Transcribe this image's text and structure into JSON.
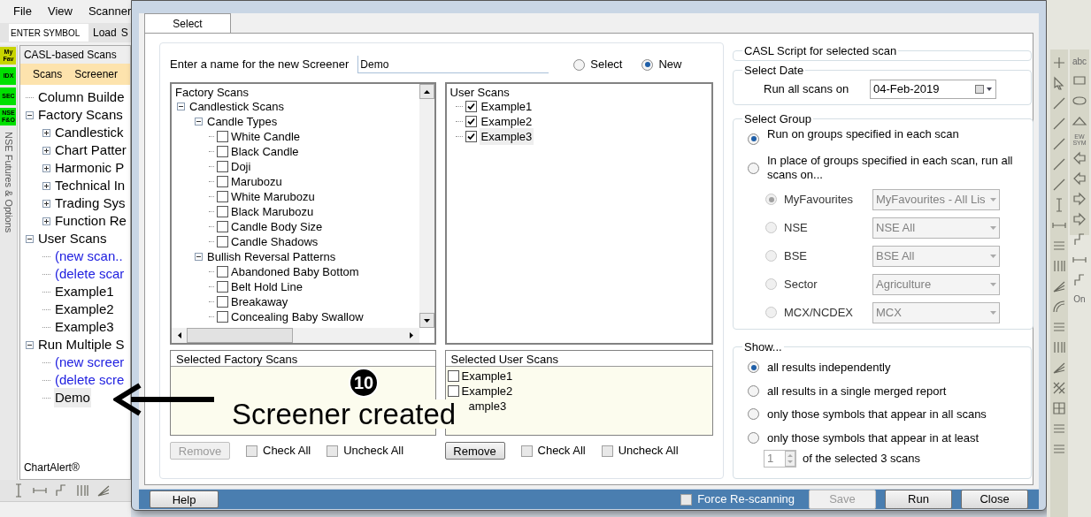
{
  "app": {
    "menu": [
      "File",
      "View",
      "Scanner"
    ],
    "symbol_field": {
      "placeholder": "ENTER SYMBOL"
    },
    "toolbar_buttons": [
      "Load",
      "S"
    ],
    "side_tabs": [
      {
        "label": "My Fav",
        "color": "#c8d400"
      },
      {
        "label": "IDX",
        "color": "#00e000"
      },
      {
        "label": "SEC",
        "color": "#00e000"
      },
      {
        "label": "NSE F&O",
        "color": "#00e000"
      }
    ],
    "vertical_tab": "NSE Futures & Options",
    "panel_title": "CASL-based Scans",
    "panel_tabs": [
      "Scans",
      "Screener"
    ],
    "tree": [
      {
        "label": "Column Builde",
        "kind": "item",
        "selected": false
      },
      {
        "label": "Factory Scans",
        "kind": "group",
        "expanded": true,
        "children": [
          {
            "label": "Candlestick",
            "kind": "group",
            "expanded": false
          },
          {
            "label": "Chart Patter",
            "kind": "group",
            "expanded": false
          },
          {
            "label": "Harmonic P",
            "kind": "group",
            "expanded": false
          },
          {
            "label": "Technical In",
            "kind": "group",
            "expanded": false
          },
          {
            "label": "Trading Sys",
            "kind": "group",
            "expanded": false
          },
          {
            "label": "Function Re",
            "kind": "group",
            "expanded": false
          }
        ]
      },
      {
        "label": "User Scans",
        "kind": "group",
        "expanded": true,
        "children": [
          {
            "label": "(new scan..",
            "kind": "link",
            "selected": false
          },
          {
            "label": "(delete scar",
            "kind": "link",
            "selected": false
          },
          {
            "label": "Example1",
            "kind": "item",
            "selected": false
          },
          {
            "label": "Example2",
            "kind": "item",
            "selected": false
          },
          {
            "label": "Example3",
            "kind": "item",
            "selected": false
          }
        ]
      },
      {
        "label": "Run Multiple S",
        "kind": "group",
        "expanded": true,
        "children": [
          {
            "label": "(new screer",
            "kind": "link",
            "selected": false
          },
          {
            "label": "(delete scre",
            "kind": "link",
            "selected": false
          },
          {
            "label": "Demo",
            "kind": "item",
            "selected": true
          }
        ]
      }
    ],
    "brand": "ChartAlert®"
  },
  "dialog": {
    "tabs": [
      {
        "label": "Select",
        "selected": true
      }
    ],
    "name_label": "Enter a name for the new Screener",
    "name_value": "Demo",
    "mode_options": [
      {
        "label": "Select",
        "selected": false
      },
      {
        "label": "New",
        "selected": true
      }
    ],
    "factory_scans": {
      "title": "Factory Scans",
      "tree": [
        {
          "label": "Candlestick Scans",
          "kind": "group",
          "expanded": true,
          "children": [
            {
              "label": "Candle Types",
              "kind": "group",
              "expanded": true,
              "children": [
                {
                  "label": "White Candle",
                  "kind": "check",
                  "checked": false
                },
                {
                  "label": "Black Candle",
                  "kind": "check",
                  "checked": false
                },
                {
                  "label": "Doji",
                  "kind": "check",
                  "checked": false
                },
                {
                  "label": "Marubozu",
                  "kind": "check",
                  "checked": false
                },
                {
                  "label": "White Marubozu",
                  "kind": "check",
                  "checked": false
                },
                {
                  "label": "Black Marubozu",
                  "kind": "check",
                  "checked": false
                },
                {
                  "label": "Candle Body Size",
                  "kind": "check",
                  "checked": false
                },
                {
                  "label": "Candle Shadows",
                  "kind": "check",
                  "checked": false
                }
              ]
            },
            {
              "label": "Bullish Reversal Patterns",
              "kind": "group",
              "expanded": true,
              "children": [
                {
                  "label": "Abandoned Baby Bottom",
                  "kind": "check",
                  "checked": false
                },
                {
                  "label": "Belt Hold Line",
                  "kind": "check",
                  "checked": false
                },
                {
                  "label": "Breakaway",
                  "kind": "check",
                  "checked": false
                },
                {
                  "label": "Concealing Baby Swallow",
                  "kind": "check",
                  "checked": false
                }
              ]
            }
          ]
        }
      ]
    },
    "user_scans": {
      "title": "User Scans",
      "items": [
        {
          "label": "Example1",
          "checked": true,
          "selected": false
        },
        {
          "label": "Example2",
          "checked": true,
          "selected": false
        },
        {
          "label": "Example3",
          "checked": true,
          "selected": true
        }
      ]
    },
    "selected_factory": {
      "title": "Selected Factory Scans"
    },
    "selected_user": {
      "title": "Selected User Scans",
      "items": [
        {
          "label": "Example1",
          "checked": false
        },
        {
          "label": "Example2",
          "checked": false
        },
        {
          "label": "ample3"
        }
      ]
    },
    "factory_actions": {
      "remove": {
        "label": "Remove",
        "disabled": true
      },
      "checks": [
        {
          "label": "Check All",
          "checked": false
        },
        {
          "label": "Uncheck All",
          "checked": false
        }
      ]
    },
    "user_actions": {
      "remove": {
        "label": "Remove",
        "disabled": false
      },
      "checks": [
        {
          "label": "Check All",
          "checked": false
        },
        {
          "label": "Uncheck All",
          "checked": false
        }
      ]
    },
    "script_group": {
      "title": "CASL Script for selected scan"
    },
    "date_group": {
      "title": "Select Date",
      "label": "Run all scans on",
      "value": "04-Feb-2019"
    },
    "group_group": {
      "title": "Select Group",
      "options": [
        {
          "label": "Run on groups specified in each scan",
          "selected": true
        },
        {
          "label": "In place of groups specified in each scan, run all scans on...",
          "selected": false
        }
      ],
      "sources": [
        {
          "label": "MyFavourites",
          "value": "MyFavourites - All Lis",
          "selected": true
        },
        {
          "label": "NSE",
          "value": "NSE All",
          "selected": false
        },
        {
          "label": "BSE",
          "value": "BSE All",
          "selected": false
        },
        {
          "label": "Sector",
          "value": "Agriculture",
          "selected": false
        },
        {
          "label": "MCX/NCDEX",
          "value": "MCX",
          "selected": false
        }
      ]
    },
    "show_group": {
      "title": "Show...",
      "options": [
        {
          "label": "all results independently",
          "selected": true
        },
        {
          "label": "all results in a single merged report",
          "selected": false
        },
        {
          "label": "only those symbols that appear in all scans",
          "selected": false
        },
        {
          "label": "only those symbols that appear in at least",
          "selected": false
        }
      ],
      "count": "1",
      "count_suffix": "of the selected 3 scans"
    },
    "footer": {
      "help": "Help",
      "force": {
        "label": "Force Re-scanning",
        "checked": false
      },
      "buttons": [
        {
          "label": "Save",
          "disabled": true
        },
        {
          "label": "Run",
          "disabled": false
        },
        {
          "label": "Close",
          "disabled": false
        }
      ]
    }
  },
  "right_toolbar": {
    "labels": [
      "abc",
      "EW SYM",
      "On"
    ]
  },
  "annotation": {
    "step": "10",
    "text": "Screener created"
  }
}
